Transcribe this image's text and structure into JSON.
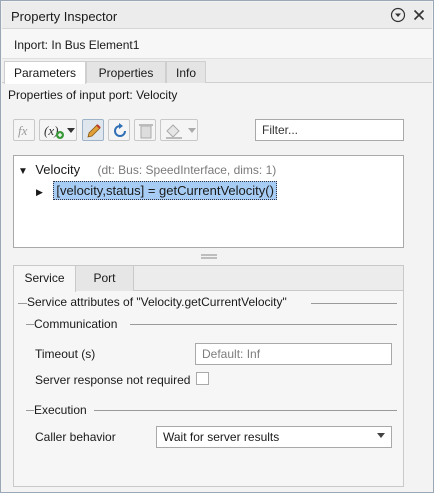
{
  "window": {
    "title": "Property Inspector"
  },
  "header": {
    "block_name": "Inport: In Bus Element1"
  },
  "tabs": [
    {
      "label": "Parameters",
      "active": true
    },
    {
      "label": "Properties",
      "active": false
    },
    {
      "label": "Info",
      "active": false
    }
  ],
  "section": {
    "label": "Properties of input port: Velocity"
  },
  "toolbar": {
    "fx_label": "fx",
    "filter_placeholder": "Filter..."
  },
  "tree": {
    "root": {
      "name": "Velocity",
      "meta": "(dt: Bus: SpeedInterface, dims: 1)"
    },
    "child": {
      "label": "[velocity,status] = getCurrentVelocity()",
      "selected": true
    }
  },
  "lower_tabs": [
    {
      "label": "Service",
      "active": true
    },
    {
      "label": "Port",
      "active": false
    }
  ],
  "service": {
    "title": "Service attributes of \"Velocity.getCurrentVelocity\"",
    "communication": {
      "title": "Communication",
      "timeout_label": "Timeout (s)",
      "timeout_placeholder": "Default: Inf",
      "server_response_label": "Server response not required",
      "server_response_checked": false
    },
    "execution": {
      "title": "Execution",
      "caller_behavior_label": "Caller behavior",
      "caller_behavior_value": "Wait for server results"
    }
  },
  "colors": {
    "selection": "#a7cdf4",
    "accent": "#2f6fb5"
  }
}
